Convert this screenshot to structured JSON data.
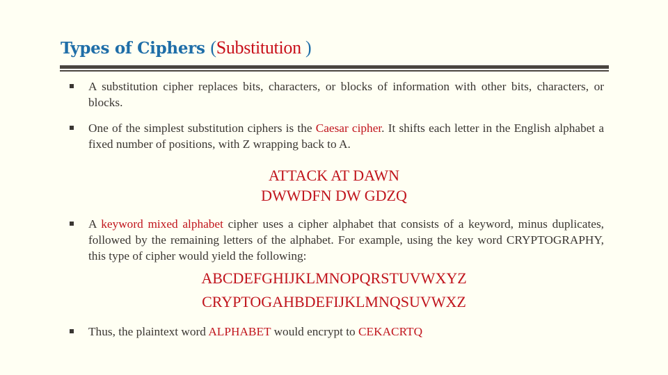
{
  "title": {
    "main": "Types of Ciphers ",
    "open_paren": "(",
    "accent": "Substitution ",
    "close_paren": ")"
  },
  "bullets": [
    {
      "text": "A substitution cipher replaces bits, characters, or blocks of information with other bits, characters, or blocks."
    },
    {
      "before": "One of the simplest substitution ciphers is the ",
      "highlight": "Caesar cipher",
      "after": ". It shifts each letter in the English alphabet a fixed number of positions, with Z wrapping back to A."
    },
    {
      "before": "A ",
      "highlight": "keyword mixed alphabet",
      "after": " cipher uses a cipher alphabet that consists of a keyword, minus duplicates, followed by the remaining letters of the alphabet. For example, using the key word CRYPTOGRAPHY, this type of cipher would yield the following:"
    },
    {
      "before": "Thus, the plaintext word ",
      "highlight": "ALPHABET",
      "middle": " would encrypt to ",
      "highlight2": "CEKACRTQ"
    }
  ],
  "caesar_example": {
    "plaintext": "ATTACK AT DAWN",
    "ciphertext": "DWWDFN DW GDZQ"
  },
  "keyword_example": {
    "plain_alphabet": "ABCDEFGHIJKLMNOPQRSTUVWXYZ",
    "cipher_alphabet": "CRYPTOGAHBDEFIJKLMNQSUVWXZ"
  },
  "colors": {
    "title": "#1f6ea8",
    "accent": "#c0141c",
    "text": "#3a3632",
    "background": "#fffff3",
    "rule": "#4a4540"
  }
}
